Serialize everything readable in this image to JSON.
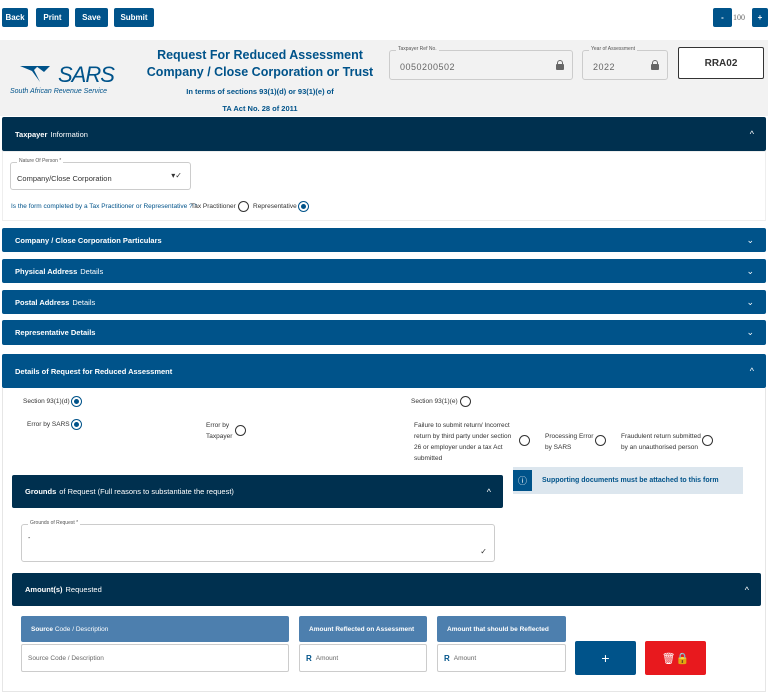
{
  "toolbar": {
    "back": "Back",
    "print": "Print",
    "save": "Save",
    "submit": "Submit",
    "zoom_out": "-",
    "zoom_level": "100",
    "zoom_in": "+"
  },
  "header": {
    "logo_text": "SARS",
    "logo_subtitle": "South African Revenue Service",
    "title_line1": "Request For Reduced Assessment",
    "title_line2": "Company / Close Corporation or Trust",
    "subtitle_line1": "In terms of sections 93(1)(d) or 93(1)(e) of",
    "subtitle_line2": "TA Act No. 28 of 2011",
    "taxpayer_ref_label": "Taxpayer Ref No.",
    "taxpayer_ref_value": "0050200502",
    "year_label": "Year of Assessment",
    "year_value": "2022",
    "form_code": "RRA02"
  },
  "taxpayer": {
    "title_bold": "Taxpayer",
    "title_rest": "Information",
    "nature_label": "Nature Of Person *",
    "nature_value": "Company/Close Corporation",
    "question": "Is the form completed by a Tax Practitioner or Representative ? *",
    "opt_practitioner": "Tax Practitioner",
    "opt_representative": "Representative",
    "selected": "Representative"
  },
  "sections": [
    {
      "bold": "Company / Close Corporation Particulars",
      "rest": ""
    },
    {
      "bold": "Physical Address",
      "rest": "Details"
    },
    {
      "bold": "Postal Address",
      "rest": "Details"
    },
    {
      "bold": "Representative Details",
      "rest": ""
    }
  ],
  "details": {
    "title": "Details of Request for Reduced Assessment",
    "section_d": "Section 93(1)(d)",
    "section_e": "Section 93(1)(e)",
    "error_sars": "Error by SARS",
    "error_taxpayer": "Error by Taxpayer",
    "failure": "Failure to submit return/ Incorrect return by third party under section 26 or employer under a tax Act submitted",
    "processing": "Processing Error by SARS",
    "fraudulent": "Fraudulent return submitted by an unauthorised person",
    "info_message": "Supporting documents must be attached to this form"
  },
  "grounds": {
    "title_bold": "Grounds",
    "title_rest": "of Request (Full reasons to substantiate the request)",
    "field_label": "Grounds of Request *",
    "field_value": "-"
  },
  "amounts": {
    "title_bold": "Amount(s)",
    "title_rest": "Requested",
    "col1_bold": "Source",
    "col1_rest": "Code / Description",
    "col2": "Amount Reflected on Assessment",
    "col3": "Amount that should be Reflected",
    "source_placeholder": "Source Code / Description",
    "currency": "R",
    "amount_placeholder": "Amount",
    "add_label": "+"
  },
  "colors": {
    "dark_header": "#00304f",
    "section_blue": "#00538a",
    "table_header": "#4d7fae",
    "delete_red": "#e8191e"
  }
}
